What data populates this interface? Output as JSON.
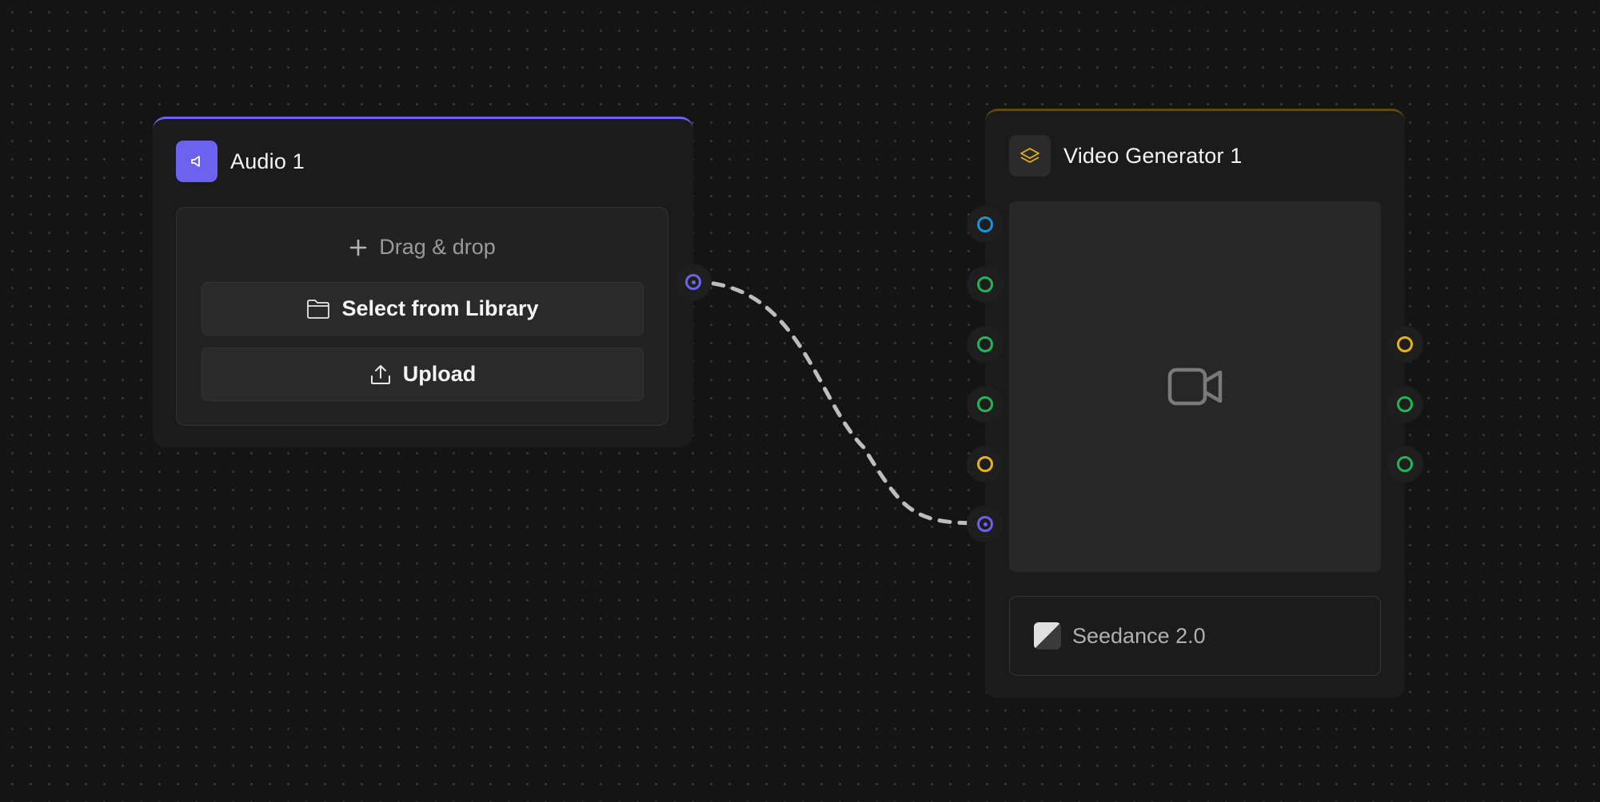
{
  "colors": {
    "background": "#141414",
    "node_bg": "#1b1b1b",
    "audio_accent": "#6b63f0",
    "video_accent": "#5e4a10",
    "port_blue": "#1e90d8",
    "port_green": "#22b457",
    "port_yellow": "#e6b21a",
    "port_purple": "#6b63f0",
    "wire": "#bdbdbd"
  },
  "audio_node": {
    "title": "Audio 1",
    "icon": "speaker-icon",
    "drag_drop_label": "Drag & drop",
    "select_library_label": "Select from Library",
    "upload_label": "Upload",
    "output_port": {
      "type": "audio",
      "color": "#6b63f0",
      "connected": true
    }
  },
  "video_node": {
    "title": "Video Generator 1",
    "icon": "layers-icon",
    "preview_icon": "video-camera-icon",
    "model_label": "Seedance 2.0",
    "model_icon": "model-logo-icon",
    "input_ports": [
      {
        "type": "text",
        "color": "#1e90d8",
        "connected": false
      },
      {
        "type": "image",
        "color": "#22b457",
        "connected": false
      },
      {
        "type": "image",
        "color": "#22b457",
        "connected": false
      },
      {
        "type": "image",
        "color": "#22b457",
        "connected": false
      },
      {
        "type": "video",
        "color": "#e6b21a",
        "connected": false
      },
      {
        "type": "audio",
        "color": "#6b63f0",
        "connected": true
      }
    ],
    "output_ports": [
      {
        "type": "video",
        "color": "#e6b21a",
        "connected": false
      },
      {
        "type": "image",
        "color": "#22b457",
        "connected": false
      },
      {
        "type": "image",
        "color": "#22b457",
        "connected": false
      }
    ]
  },
  "connection": {
    "from": "audio_node.output",
    "to": "video_node.input.audio",
    "style": "dashed"
  }
}
